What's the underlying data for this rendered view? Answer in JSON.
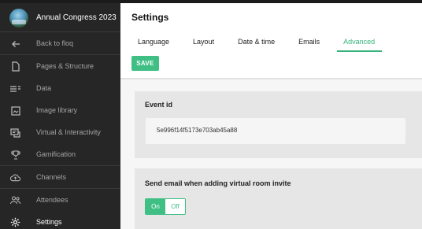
{
  "sidebar": {
    "event_name": "Annual Congress 2023",
    "items": [
      {
        "label": "Back to floq",
        "icon": "arrow-left-icon"
      },
      {
        "label": "Pages & Structure",
        "icon": "page-icon"
      },
      {
        "label": "Data",
        "icon": "list-icon"
      },
      {
        "label": "Image library",
        "icon": "image-icon"
      },
      {
        "label": "Virtual & Interactivity",
        "icon": "chat-screen-icon"
      },
      {
        "label": "Gamification",
        "icon": "trophy-icon"
      },
      {
        "label": "Channels",
        "icon": "cloud-upload-icon"
      },
      {
        "label": "Attendees",
        "icon": "people-icon"
      },
      {
        "label": "Settings",
        "icon": "gear-icon"
      }
    ]
  },
  "main": {
    "title": "Settings",
    "tabs": [
      {
        "label": "Language"
      },
      {
        "label": "Layout"
      },
      {
        "label": "Date & time"
      },
      {
        "label": "Emails"
      },
      {
        "label": "Advanced"
      }
    ],
    "save_label": "SAVE",
    "event_id_section": {
      "title": "Event id",
      "value": "5e996f14f5173e703ab45a88"
    },
    "email_section": {
      "title": "Send email when adding virtual room invite",
      "on_label": "On",
      "off_label": "Off"
    }
  },
  "colors": {
    "accent": "#3fbf84",
    "sidebar_bg": "#262626",
    "card_bg": "#e6e6e6"
  }
}
